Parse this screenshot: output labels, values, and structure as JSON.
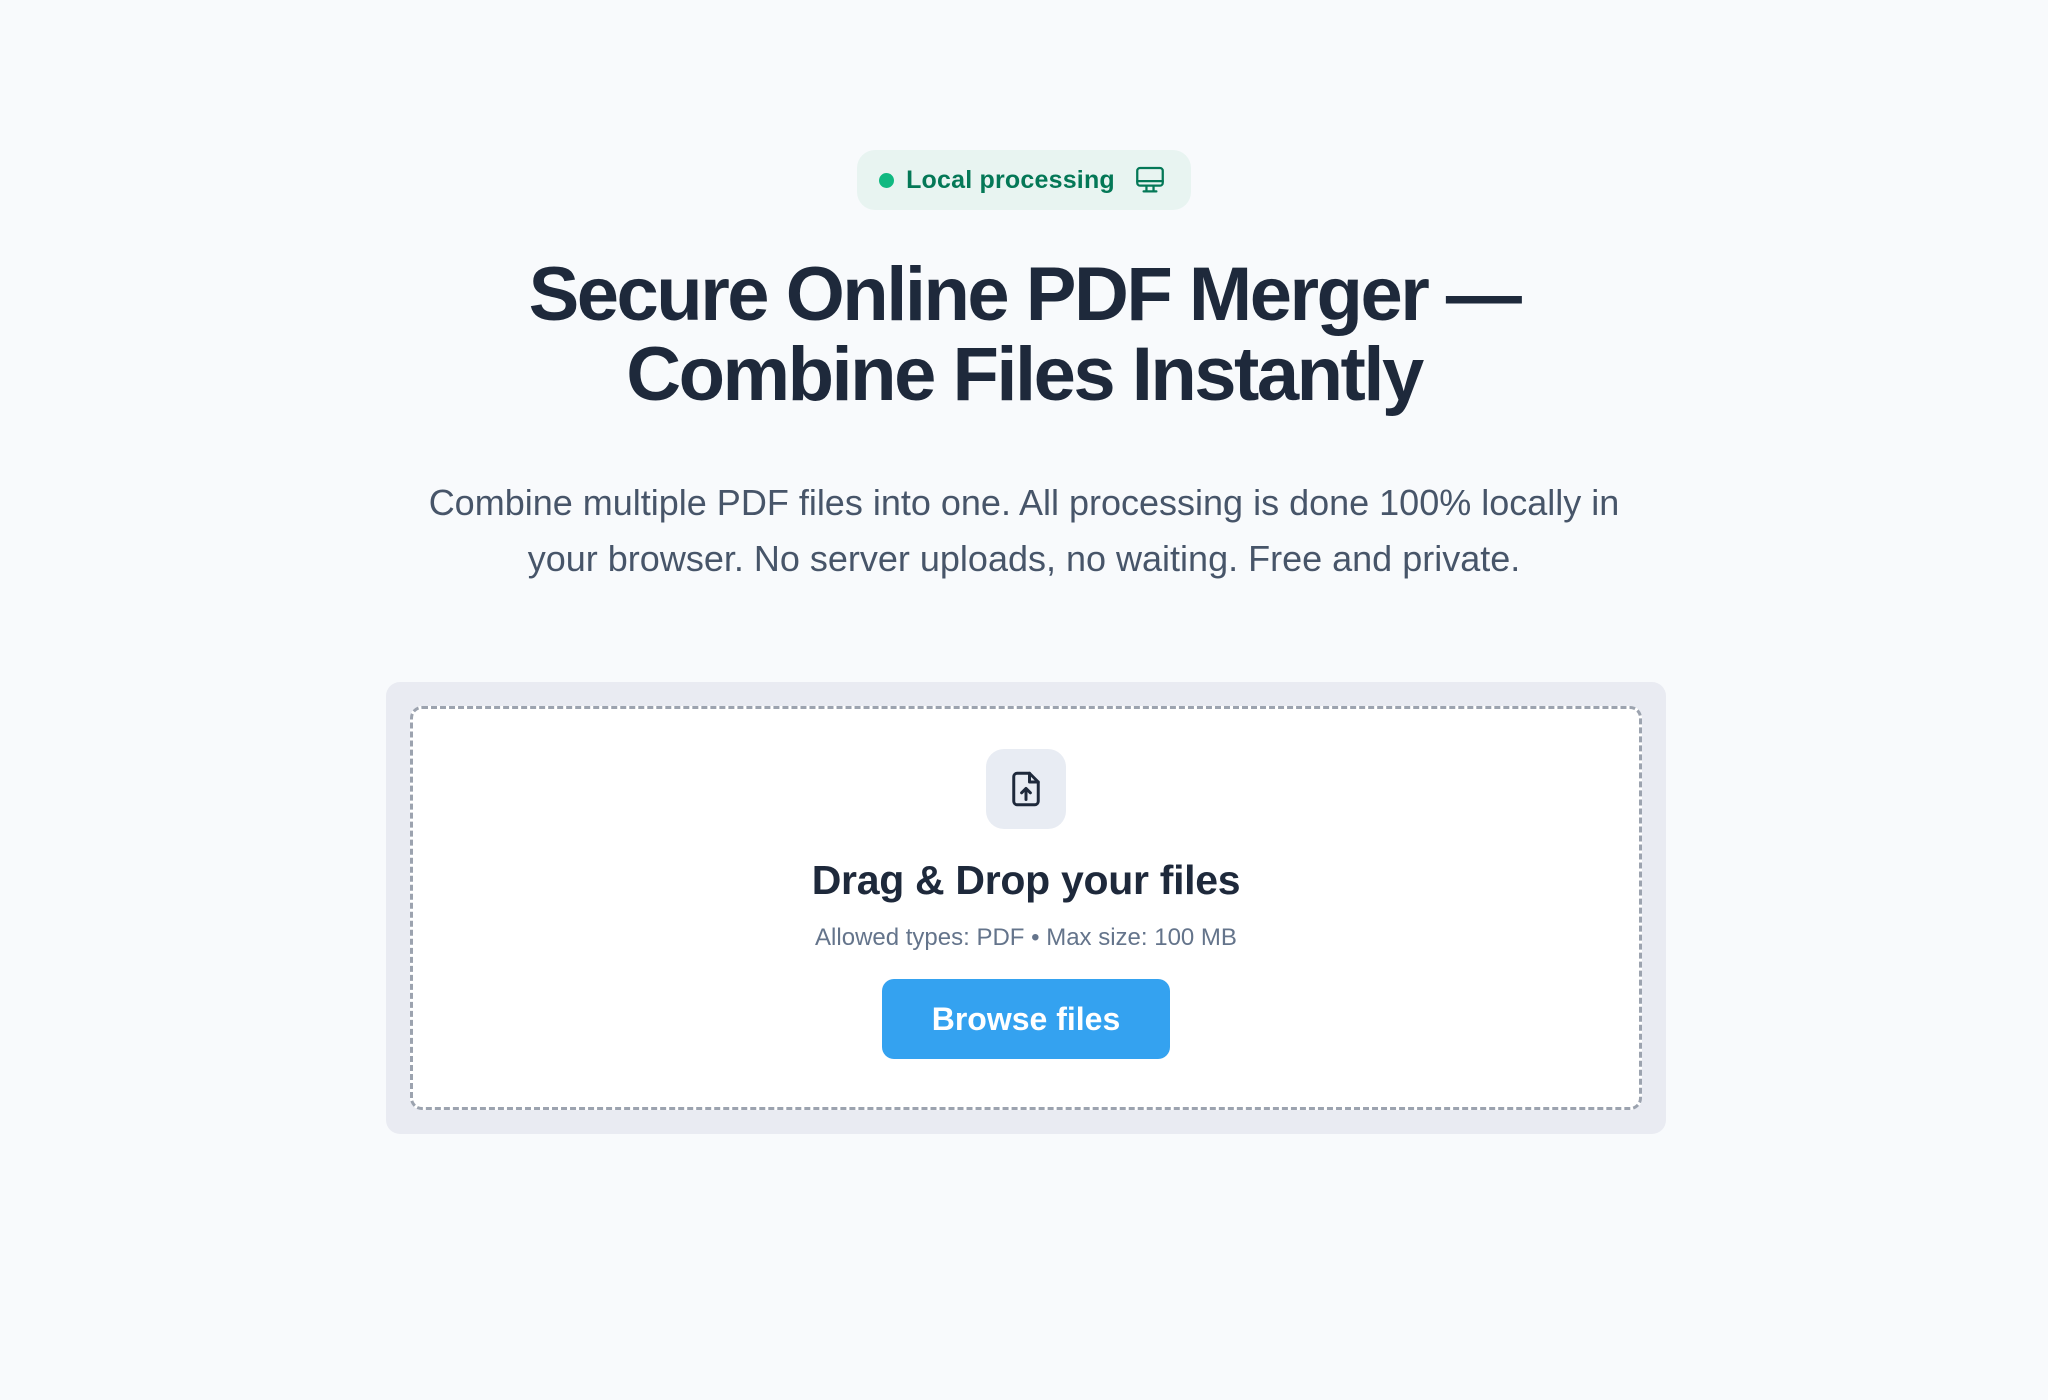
{
  "badge": {
    "label": "Local processing",
    "dot_color": "#10b981",
    "icon": "monitor-icon"
  },
  "hero": {
    "title_line1": "Secure Online PDF Merger —",
    "title_line2": "Combine Files Instantly",
    "subtitle": "Combine multiple PDF files into one. All processing is done 100% locally in your browser. No server uploads, no waiting. Free and private."
  },
  "dropzone": {
    "icon": "file-upload-icon",
    "title": "Drag & Drop your files",
    "hint": "Allowed types: PDF • Max size: 100 MB",
    "browse_label": "Browse files",
    "button_color": "#34a2f0"
  }
}
